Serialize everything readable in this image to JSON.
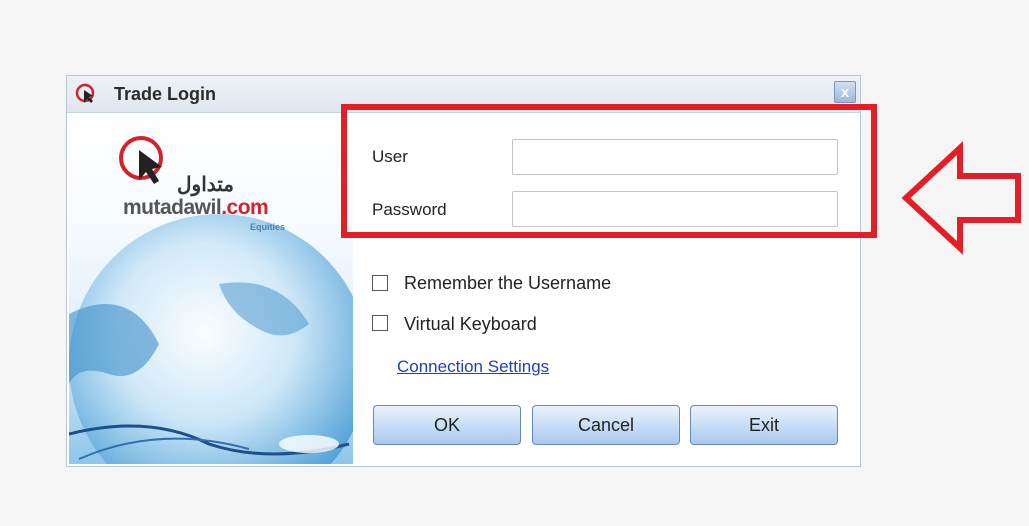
{
  "window": {
    "title": "Trade Login",
    "close_label": "x"
  },
  "branding": {
    "name_prefix": "mutadawil",
    "name_suffix": ".com",
    "arabic_name": "متداول",
    "subtitle": "Equities"
  },
  "form": {
    "user_label": "User",
    "user_value": "",
    "password_label": "Password",
    "password_value": ""
  },
  "options": {
    "remember_label": "Remember the Username",
    "remember_checked": false,
    "keyboard_label": "Virtual Keyboard",
    "keyboard_checked": false
  },
  "link": {
    "connection_settings": "Connection Settings "
  },
  "buttons": {
    "ok": "OK",
    "cancel": "Cancel",
    "exit": "Exit"
  },
  "colors": {
    "highlight": "#e41e26",
    "link": "#1e3fbe"
  }
}
